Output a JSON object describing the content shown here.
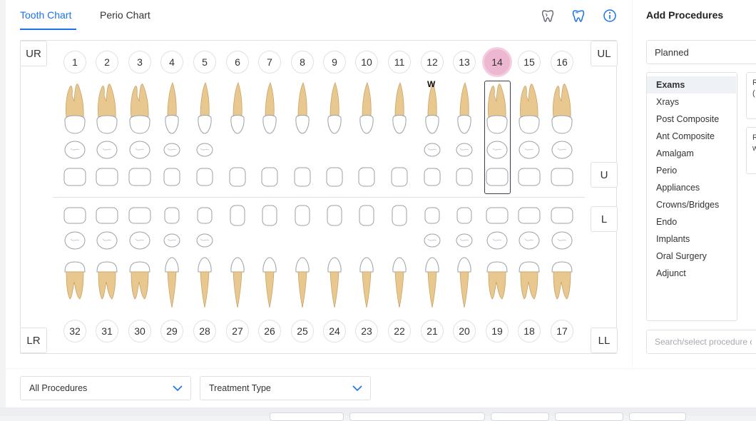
{
  "tabs": [
    {
      "label": "Tooth Chart",
      "active": true
    },
    {
      "label": "Perio Chart",
      "active": false
    }
  ],
  "toolbar_icons": [
    "tooth-outline-icon",
    "tooth-filled-icon",
    "info-icon"
  ],
  "quadrants": {
    "upper_right": "UR",
    "upper_left": "UL",
    "lower_right": "LR",
    "lower_left": "LL"
  },
  "arch_buttons": {
    "upper": "U",
    "lower": "L"
  },
  "upper_teeth": [
    1,
    2,
    3,
    4,
    5,
    6,
    7,
    8,
    9,
    10,
    11,
    12,
    13,
    14,
    15,
    16
  ],
  "lower_teeth": [
    32,
    31,
    30,
    29,
    28,
    27,
    26,
    25,
    24,
    23,
    22,
    21,
    20,
    19,
    18,
    17
  ],
  "selected_tooth": 14,
  "tooth_marks": {
    "12": "W"
  },
  "colors": {
    "accent": "#1a73e8",
    "selected": "#eeb7d1",
    "root": "#e9c88f"
  },
  "panel": {
    "title": "Add Procedures",
    "status_select": "Planned",
    "categories": [
      "Exams",
      "Xrays",
      "Post Composite",
      "Ant Composite",
      "Amalgam",
      "Perio",
      "Appliances",
      "Crowns/Bridges",
      "Endo",
      "Implants",
      "Oral Surgery",
      "Adjunct"
    ],
    "active_category": "Exams",
    "cards": [
      "R\n(",
      "R\nw"
    ],
    "search_placeholder": "Search/select procedure c"
  },
  "filters": {
    "procedures": "All Procedures",
    "treatment_type": "Treatment Type"
  }
}
